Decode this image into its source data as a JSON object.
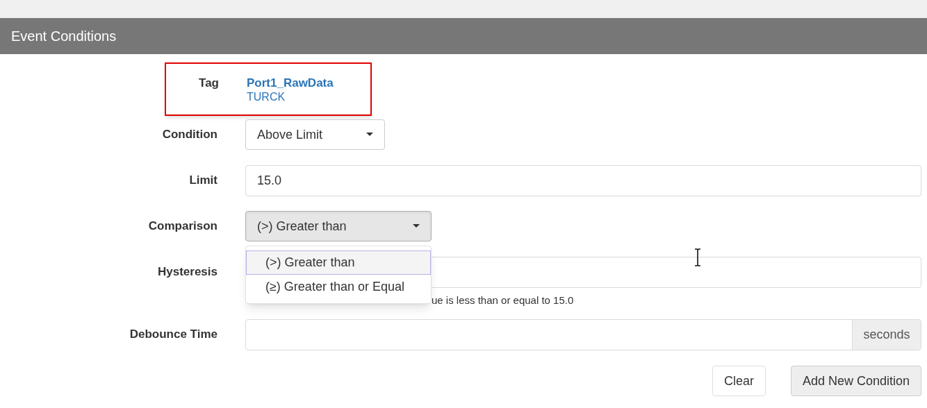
{
  "panel": {
    "title": "Event Conditions"
  },
  "tag": {
    "label": "Tag",
    "name": "Port1_RawData",
    "source": "TURCK",
    "highlighted": true
  },
  "fields": [
    {
      "kind": "select",
      "label": "Condition",
      "value": "Above Limit",
      "expanded": false
    },
    {
      "kind": "input",
      "label": "Limit",
      "value": "15.0"
    },
    {
      "kind": "select",
      "label": "Comparison",
      "value": "(>) Greater than",
      "expanded": true,
      "options": [
        {
          "label": "(>) Greater than",
          "selected": true
        },
        {
          "label": "(≥) Greater than or Equal",
          "selected": false
        }
      ]
    },
    {
      "kind": "input",
      "label": "Hysteresis",
      "help": "ue is less than or equal to 15.0"
    },
    {
      "kind": "addon",
      "label": "Debounce Time",
      "addon": "seconds"
    }
  ],
  "buttons": [
    {
      "label": "Clear",
      "primary": false
    },
    {
      "label": "Add New Condition",
      "primary": true
    }
  ]
}
